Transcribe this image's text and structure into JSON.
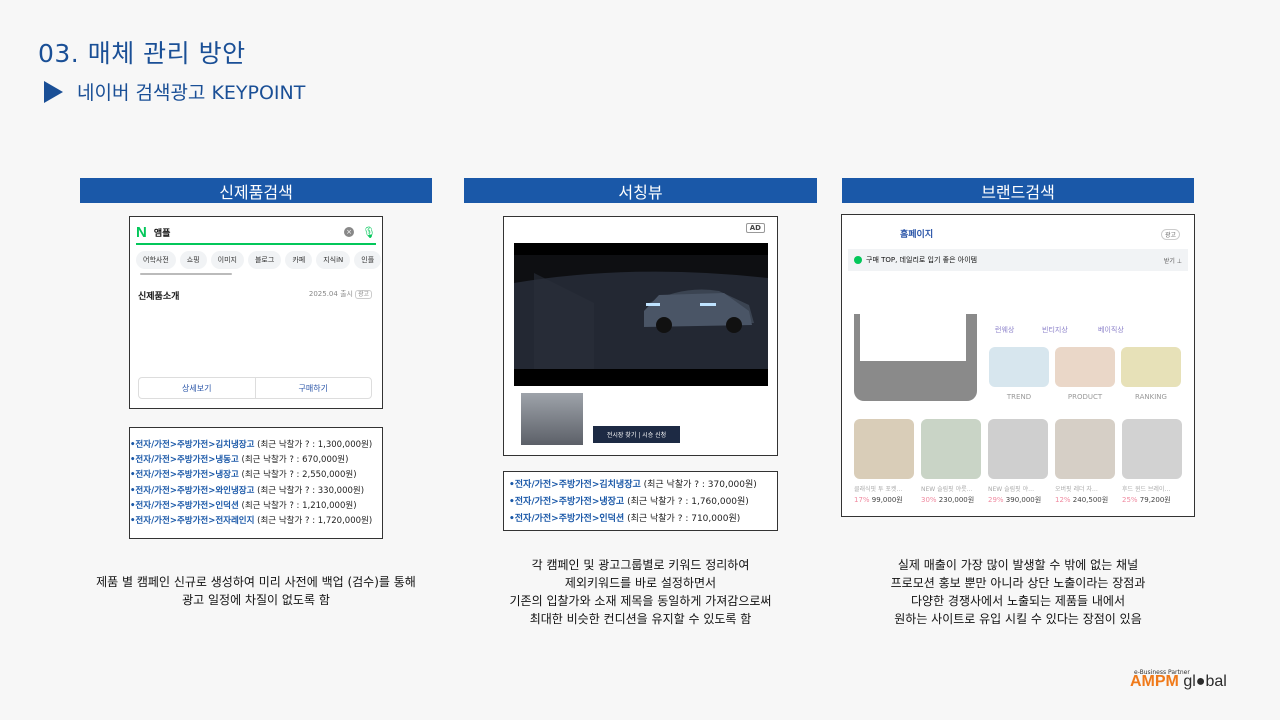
{
  "header": {
    "title": "03. 매체 관리 방안",
    "subtitle": "네이버 검색광고 KEYPOINT"
  },
  "columns": [
    {
      "header": "신제품검색",
      "search_mock": {
        "query": "앰플",
        "tabs": [
          "어학사전",
          "쇼핑",
          "이미지",
          "블로그",
          "카페",
          "지식iN",
          "인플"
        ],
        "section_title": "신제품소개",
        "date": "2025.04 출시",
        "ad_badge": "광고",
        "buttons": [
          "상세보기",
          "구매하기"
        ]
      },
      "keywords": [
        {
          "kw": "•전자/가전>주방가전>김치냉장고",
          "rest": " (최근 낙찰가 ? : 1,300,000원)"
        },
        {
          "kw": "•전자/가전>주방가전>냉동고",
          "rest": " (최근 낙찰가 ? : 670,000원)"
        },
        {
          "kw": "•전자/가전>주방가전>냉장고",
          "rest": " (최근 낙찰가 ? : 2,550,000원)"
        },
        {
          "kw": "•전자/가전>주방가전>와인냉장고",
          "rest": " (최근 낙찰가 ? : 330,000원)"
        },
        {
          "kw": "•전자/가전>주방가전>인덕션",
          "rest": " (최근 낙찰가 ? : 1,210,000원)"
        },
        {
          "kw": "•전자/가전>주방가전>전자레인지",
          "rest": " (최근 낙찰가 ? : 1,720,000원)"
        }
      ],
      "desc": [
        "제품 별 캠페인 신규로 생성하여  미리 사전에 백업 (검수)를 통해",
        "광고 일정에 차질이 없도록  함"
      ]
    },
    {
      "header": "서칭뷰",
      "video_mock": {
        "ad_badge": "AD",
        "cta": "전시장 찾기  |  시승 신청"
      },
      "keywords": [
        {
          "kw": "•전자/가전>주방가전>김치냉장고",
          "rest": " (최근 낙찰가 ? : 370,000원)"
        },
        {
          "kw": "•전자/가전>주방가전>냉장고",
          "rest": " (최근 낙찰가 ? : 1,760,000원)"
        },
        {
          "kw": "•전자/가전>주방가전>인덕션",
          "rest": " (최근 낙찰가 ? : 710,000원)"
        }
      ],
      "desc": [
        "각 캠페인 및 광고그룹별로  키워드 정리하여",
        "제외키워드를  바로 설정하면서",
        "기존의 입찰가와 소재 제목을 동일하게  가져감으로써",
        "최대한 비슷한 컨디션을 유지할 수 있도록  함"
      ]
    },
    {
      "header": "브랜드검색",
      "brand_mock": {
        "home": "홈페이지",
        "badge": "광고",
        "notice": "구매 TOP, 데일리로 입기 좋은 아이템",
        "notice_btn": "받기 ⊥",
        "tags": [
          "런웨상",
          "빈티지상",
          "베이직상"
        ],
        "categories": [
          "TREND",
          "PRODUCT",
          "RANKING"
        ],
        "products": [
          {
            "name": "클래식핏 투 포켓…",
            "pct": "17%",
            "price": "99,000원"
          },
          {
            "name": "NEW 슬림핏 야릇…",
            "pct": "30%",
            "price": "230,000원"
          },
          {
            "name": "NEW 슬림핏 야…",
            "pct": "29%",
            "price": "390,000원"
          },
          {
            "name": "오버핏 레더 자…",
            "pct": "12%",
            "price": "240,500원"
          },
          {
            "name": "후드 윈드 브레이…",
            "pct": "25%",
            "price": "79,200원"
          }
        ]
      },
      "desc": [
        "실제 매출이 가장 많이 발생할 수 밖에 없는 채널",
        "프로모션 홍보 뿐만 아니라 상단 노출이라는 장점과",
        "다양한 경쟁사에서  노출되는 제품들 내에서",
        "원하는 사이트로 유입 시킬 수 있다는 장점이 있음"
      ]
    }
  ],
  "logo": {
    "tagline": "e-Business Partner",
    "brand_a": "AMPM",
    "brand_b": "gl●bal"
  },
  "colors": {
    "accent": "#1a58a8",
    "title": "#1a4f96",
    "naver_green": "#03c75a"
  }
}
